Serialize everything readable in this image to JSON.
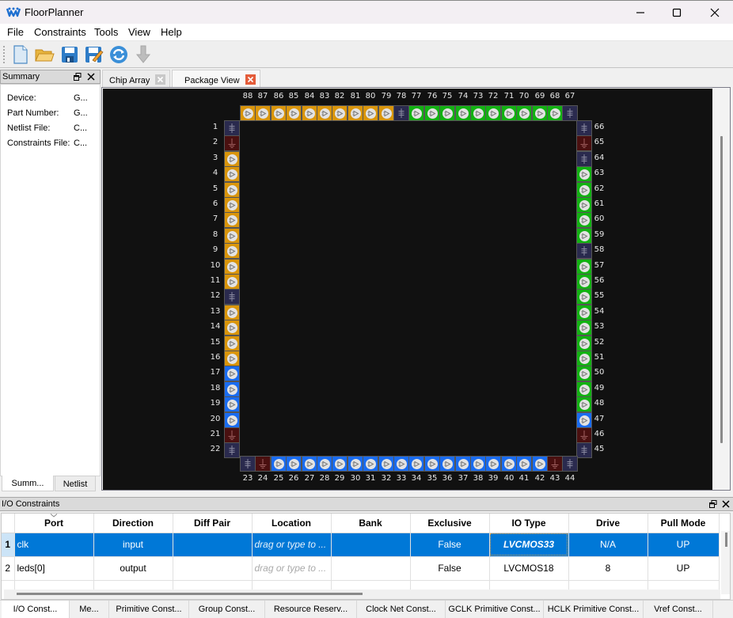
{
  "window": {
    "title": "FloorPlanner",
    "minimize_label": "minimize",
    "maximize_label": "maximize",
    "close_label": "close"
  },
  "menu": [
    "File",
    "Constraints",
    "Tools",
    "View",
    "Help"
  ],
  "toolbar": {
    "buttons": [
      "new-file",
      "open-folder",
      "save",
      "save-as",
      "refresh",
      "download"
    ]
  },
  "summary": {
    "title": "Summary",
    "rows": [
      {
        "label": "Device:",
        "value": "G..."
      },
      {
        "label": "Part Number:",
        "value": "G..."
      },
      {
        "label": "Netlist File:",
        "value": "C..."
      },
      {
        "label": "Constraints File:",
        "value": "C..."
      }
    ],
    "tabs": [
      "Summ...",
      "Netlist"
    ]
  },
  "center_tabs": [
    {
      "label": "Chip Array",
      "active": false
    },
    {
      "label": "Package View",
      "active": true
    }
  ],
  "package": {
    "colors": {
      "yellow": "#d9950b",
      "green": "#12b112",
      "blue": "#1a6cf0",
      "vdd": "#2a2a4e",
      "gnd": "#4a1010"
    },
    "top": [
      {
        "n": "88",
        "t": "yellow"
      },
      {
        "n": "87",
        "t": "yellow"
      },
      {
        "n": "86",
        "t": "yellow"
      },
      {
        "n": "85",
        "t": "yellow"
      },
      {
        "n": "84",
        "t": "yellow"
      },
      {
        "n": "83",
        "t": "yellow"
      },
      {
        "n": "82",
        "t": "yellow"
      },
      {
        "n": "81",
        "t": "yellow"
      },
      {
        "n": "80",
        "t": "yellow"
      },
      {
        "n": "79",
        "t": "yellow"
      },
      {
        "n": "78",
        "t": "vdd"
      },
      {
        "n": "77",
        "t": "green"
      },
      {
        "n": "76",
        "t": "green"
      },
      {
        "n": "75",
        "t": "green"
      },
      {
        "n": "74",
        "t": "green"
      },
      {
        "n": "73",
        "t": "green"
      },
      {
        "n": "72",
        "t": "green"
      },
      {
        "n": "71",
        "t": "green"
      },
      {
        "n": "70",
        "t": "green"
      },
      {
        "n": "69",
        "t": "green"
      },
      {
        "n": "68",
        "t": "green"
      },
      {
        "n": "67",
        "t": "vdd"
      }
    ],
    "left": [
      {
        "n": "1",
        "t": "vdd"
      },
      {
        "n": "2",
        "t": "gnd"
      },
      {
        "n": "3",
        "t": "yellow"
      },
      {
        "n": "4",
        "t": "yellow"
      },
      {
        "n": "5",
        "t": "yellow"
      },
      {
        "n": "6",
        "t": "yellow"
      },
      {
        "n": "7",
        "t": "yellow"
      },
      {
        "n": "8",
        "t": "yellow"
      },
      {
        "n": "9",
        "t": "yellow"
      },
      {
        "n": "10",
        "t": "yellow"
      },
      {
        "n": "11",
        "t": "yellow"
      },
      {
        "n": "12",
        "t": "vdd"
      },
      {
        "n": "13",
        "t": "yellow"
      },
      {
        "n": "14",
        "t": "yellow"
      },
      {
        "n": "15",
        "t": "yellow"
      },
      {
        "n": "16",
        "t": "yellow"
      },
      {
        "n": "17",
        "t": "blue"
      },
      {
        "n": "18",
        "t": "blue"
      },
      {
        "n": "19",
        "t": "blue"
      },
      {
        "n": "20",
        "t": "blue"
      },
      {
        "n": "21",
        "t": "gnd"
      },
      {
        "n": "22",
        "t": "vdd"
      }
    ],
    "bottom": [
      {
        "n": "23",
        "t": "vdd"
      },
      {
        "n": "24",
        "t": "gnd"
      },
      {
        "n": "25",
        "t": "blue"
      },
      {
        "n": "26",
        "t": "blue"
      },
      {
        "n": "27",
        "t": "blue"
      },
      {
        "n": "28",
        "t": "blue"
      },
      {
        "n": "29",
        "t": "blue"
      },
      {
        "n": "30",
        "t": "blue"
      },
      {
        "n": "31",
        "t": "blue"
      },
      {
        "n": "32",
        "t": "blue"
      },
      {
        "n": "33",
        "t": "blue"
      },
      {
        "n": "34",
        "t": "blue"
      },
      {
        "n": "35",
        "t": "blue"
      },
      {
        "n": "36",
        "t": "blue"
      },
      {
        "n": "37",
        "t": "blue"
      },
      {
        "n": "38",
        "t": "blue"
      },
      {
        "n": "39",
        "t": "blue"
      },
      {
        "n": "40",
        "t": "blue"
      },
      {
        "n": "41",
        "t": "blue"
      },
      {
        "n": "42",
        "t": "blue"
      },
      {
        "n": "43",
        "t": "gnd"
      },
      {
        "n": "44",
        "t": "vdd"
      }
    ],
    "right": [
      {
        "n": "66",
        "t": "vdd"
      },
      {
        "n": "65",
        "t": "gnd"
      },
      {
        "n": "64",
        "t": "vdd"
      },
      {
        "n": "63",
        "t": "green"
      },
      {
        "n": "62",
        "t": "green"
      },
      {
        "n": "61",
        "t": "green"
      },
      {
        "n": "60",
        "t": "green"
      },
      {
        "n": "59",
        "t": "green"
      },
      {
        "n": "58",
        "t": "vdd"
      },
      {
        "n": "57",
        "t": "green"
      },
      {
        "n": "56",
        "t": "green"
      },
      {
        "n": "55",
        "t": "green"
      },
      {
        "n": "54",
        "t": "green"
      },
      {
        "n": "53",
        "t": "green"
      },
      {
        "n": "52",
        "t": "green"
      },
      {
        "n": "51",
        "t": "green"
      },
      {
        "n": "50",
        "t": "green"
      },
      {
        "n": "49",
        "t": "green"
      },
      {
        "n": "48",
        "t": "green"
      },
      {
        "n": "47",
        "t": "blue"
      },
      {
        "n": "46",
        "t": "gnd"
      },
      {
        "n": "45",
        "t": "vdd"
      }
    ]
  },
  "io_constraints": {
    "title": "I/O Constraints",
    "columns": [
      "Port",
      "Direction",
      "Diff Pair",
      "Location",
      "Bank",
      "Exclusive",
      "IO Type",
      "Drive",
      "Pull Mode"
    ],
    "rows": [
      {
        "num": "1",
        "cells": [
          "clk",
          "input",
          "",
          "drag or type to ...",
          "",
          "False",
          "LVCMOS33",
          "N/A",
          "UP"
        ],
        "selected": true
      },
      {
        "num": "2",
        "cells": [
          "leds[0]",
          "output",
          "",
          "drag or type to ...",
          "",
          "False",
          "LVCMOS18",
          "8",
          "UP"
        ],
        "selected": false
      },
      {
        "num": "",
        "cells": [
          "",
          "",
          "",
          "",
          "",
          "",
          "",
          "",
          ""
        ],
        "selected": false
      }
    ],
    "tabs": [
      "I/O Const...",
      "Me...",
      "Primitive Const...",
      "Group Const...",
      "Resource Reserv...",
      "Clock Net Const...",
      "GCLK Primitive Const...",
      "HCLK Primitive Const...",
      "Vref Const..."
    ]
  }
}
